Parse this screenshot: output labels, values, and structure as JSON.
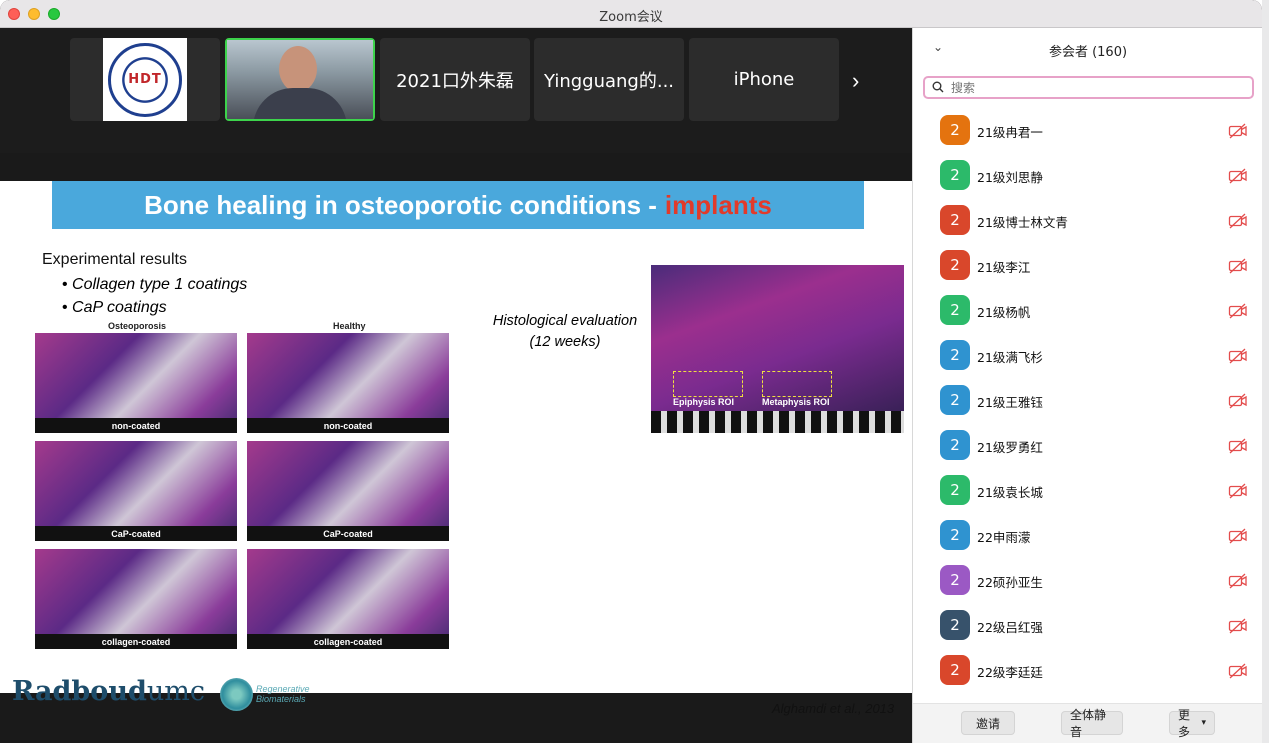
{
  "window": {
    "title": "Zoom会议"
  },
  "thumbnails": [
    {
      "kind": "logo",
      "logo_text": "HDT"
    },
    {
      "kind": "video"
    },
    {
      "kind": "name",
      "label": "2021口外朱磊"
    },
    {
      "kind": "name",
      "label": "Yingguang的..."
    },
    {
      "kind": "name",
      "label": "iPhone"
    }
  ],
  "thumb_next": "›",
  "slide": {
    "title_main": "Bone healing in osteoporotic conditions -",
    "title_accent": "implants",
    "intro": "Experimental results",
    "bullets": [
      "Collagen type 1 coatings",
      "CaP coatings"
    ],
    "col_labels": [
      "Osteoporosis",
      "Healthy"
    ],
    "panel_captions": [
      "non-coated",
      "non-coated",
      "CaP-coated",
      "CaP-coated",
      "collagen-coated",
      "collagen-coated"
    ],
    "histo_label_line1": "Histological evaluation",
    "histo_label_line2": "(12 weeks)",
    "roi_labels": [
      "Epiphysis ROI",
      "Metaphysis ROI"
    ],
    "logo_main": "Radboud",
    "logo_suffix": "umc",
    "regen_line1": "Regenerative",
    "regen_line2": "Biomaterials",
    "citation": "Alghamdi et al., 2013"
  },
  "participants_panel": {
    "title": "参会者 (160)",
    "search_placeholder": "搜索",
    "participants": [
      {
        "avatar": "2",
        "name": "21级冉君一",
        "color": "#e4730f"
      },
      {
        "avatar": "2",
        "name": "21级刘思静",
        "color": "#2cba6a"
      },
      {
        "avatar": "2",
        "name": "21级博士林文青",
        "color": "#d9472b"
      },
      {
        "avatar": "2",
        "name": "21级李江",
        "color": "#d9472b"
      },
      {
        "avatar": "2",
        "name": "21级杨帆",
        "color": "#2cba6a"
      },
      {
        "avatar": "2",
        "name": "21级满飞杉",
        "color": "#2f93d0"
      },
      {
        "avatar": "2",
        "name": "21级王雅钰",
        "color": "#2f93d0"
      },
      {
        "avatar": "2",
        "name": "21级罗勇红",
        "color": "#2f93d0"
      },
      {
        "avatar": "2",
        "name": "21级袁长城",
        "color": "#2cba6a"
      },
      {
        "avatar": "2",
        "name": "22申雨濛",
        "color": "#2f93d0"
      },
      {
        "avatar": "2",
        "name": "22硕孙亚生",
        "color": "#9b59c4"
      },
      {
        "avatar": "2",
        "name": "22级吕红强",
        "color": "#37526b"
      },
      {
        "avatar": "2",
        "name": "22级李廷廷",
        "color": "#d9472b"
      }
    ],
    "footer": {
      "invite": "邀请",
      "mute_all": "全体静音",
      "more": "更多"
    }
  }
}
